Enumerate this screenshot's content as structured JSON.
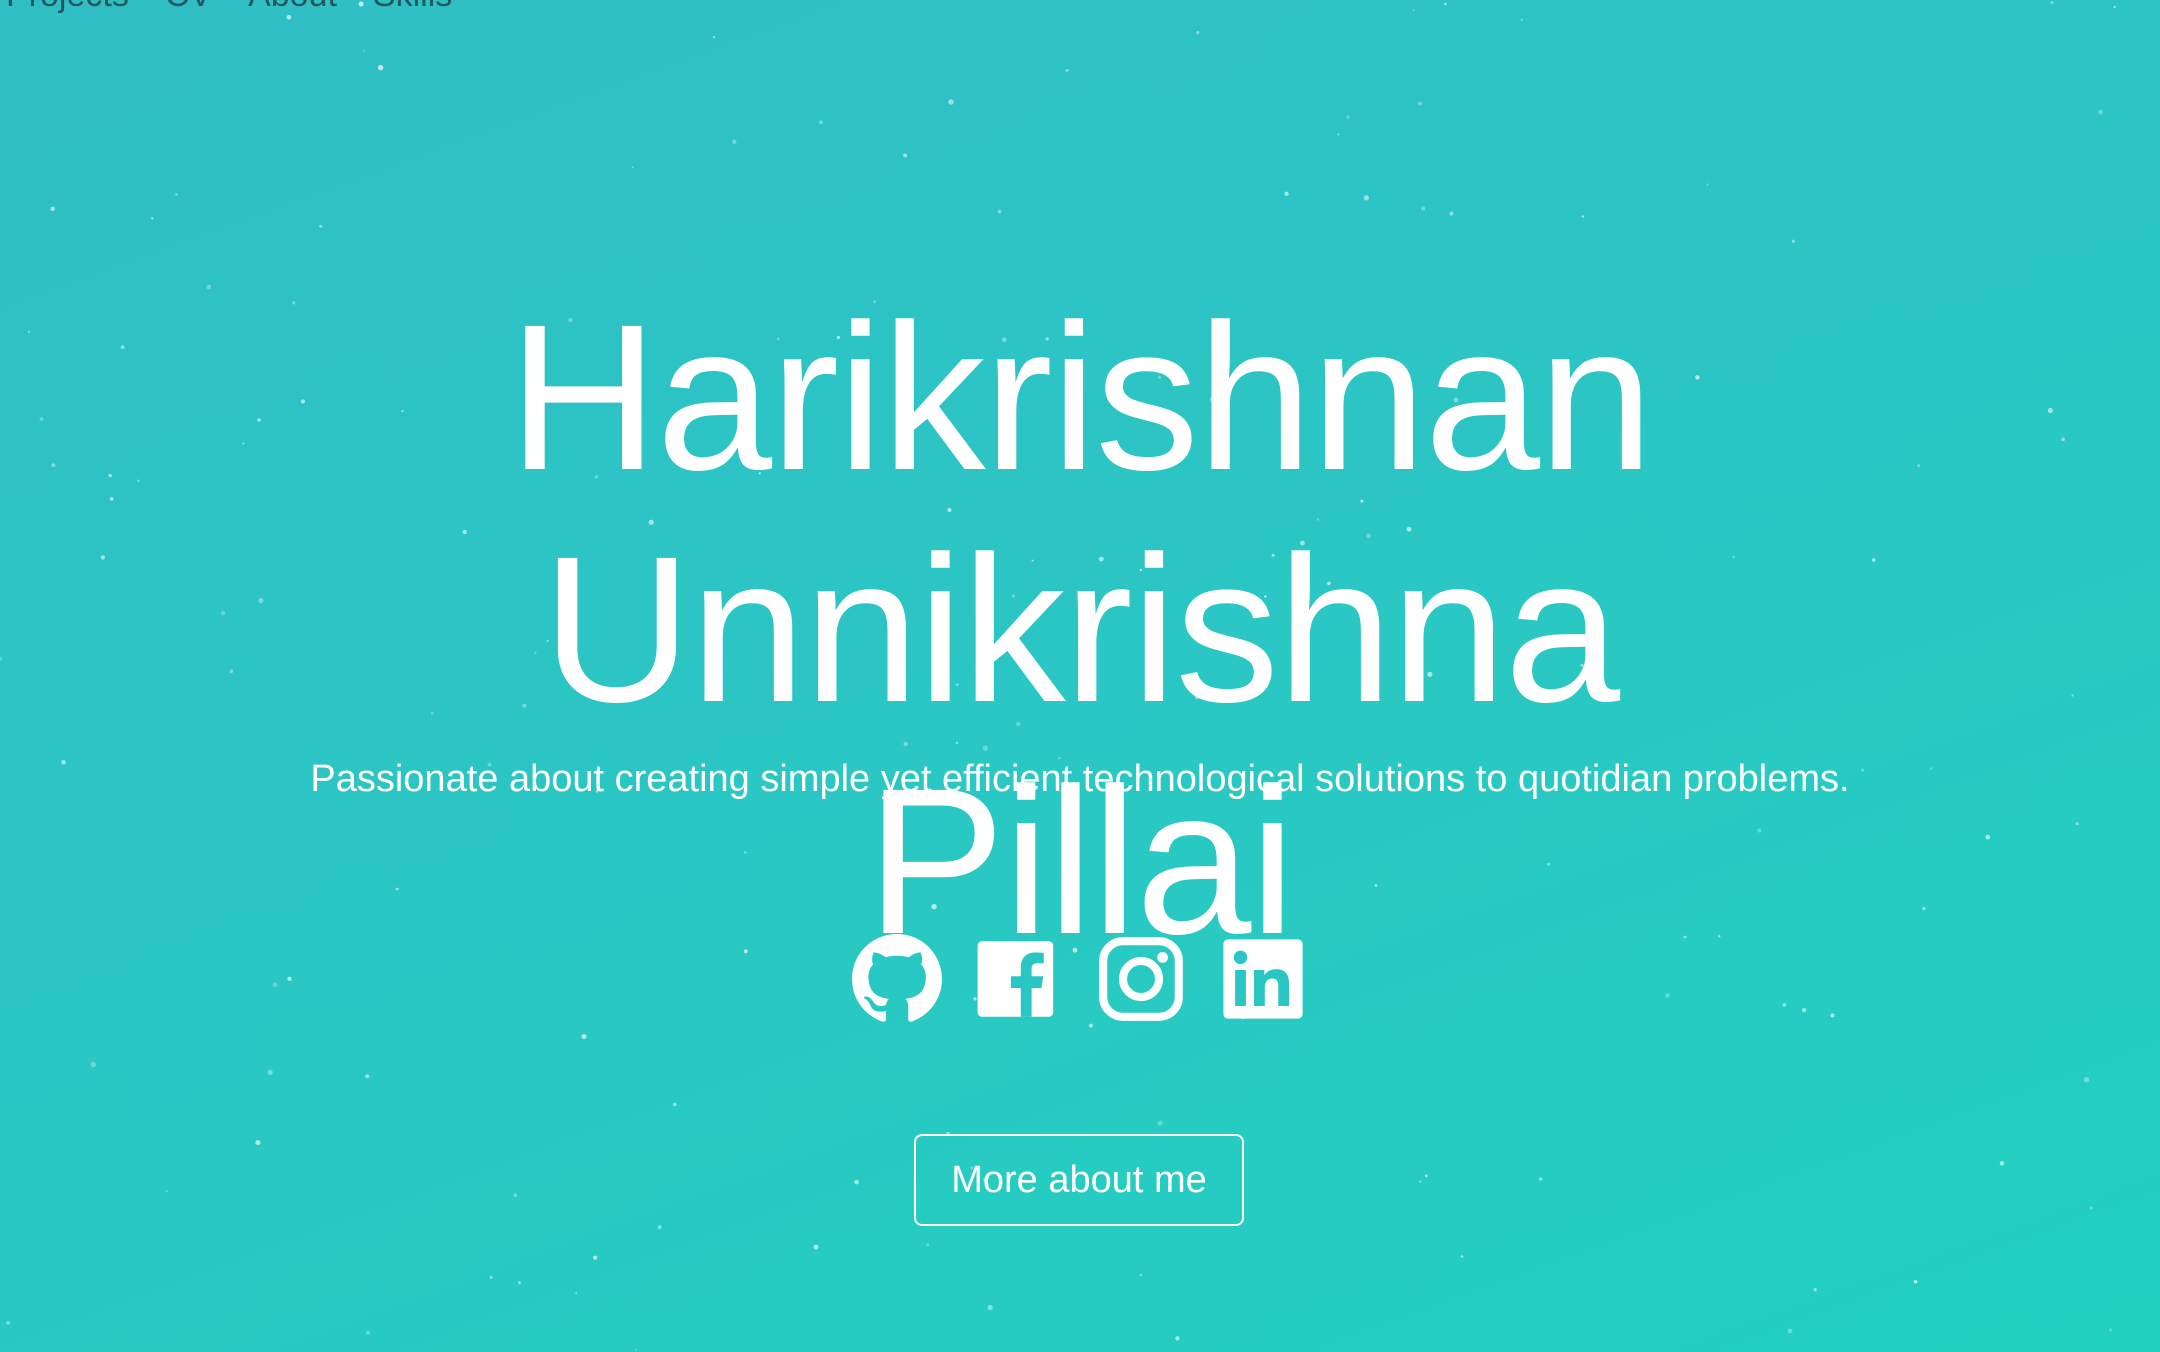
{
  "nav": {
    "items": [
      {
        "label": "Projects"
      },
      {
        "label": "CV"
      },
      {
        "label": "About"
      },
      {
        "label": "Skills"
      }
    ]
  },
  "hero": {
    "name_line1": "Harikrishnan Unnikrishna",
    "name_line2": "Pillai",
    "tagline": "Passionate about creating simple yet efficient technological solutions to quotidian problems.",
    "cta_label": "More about me"
  },
  "socials": [
    {
      "icon": "github-icon"
    },
    {
      "icon": "facebook-icon"
    },
    {
      "icon": "instagram-icon"
    },
    {
      "icon": "linkedin-icon"
    }
  ],
  "colors": {
    "gradient_start": "#30bec5",
    "gradient_end": "#22d0c0",
    "text": "#ffffff",
    "nav_text": "#23595e"
  }
}
